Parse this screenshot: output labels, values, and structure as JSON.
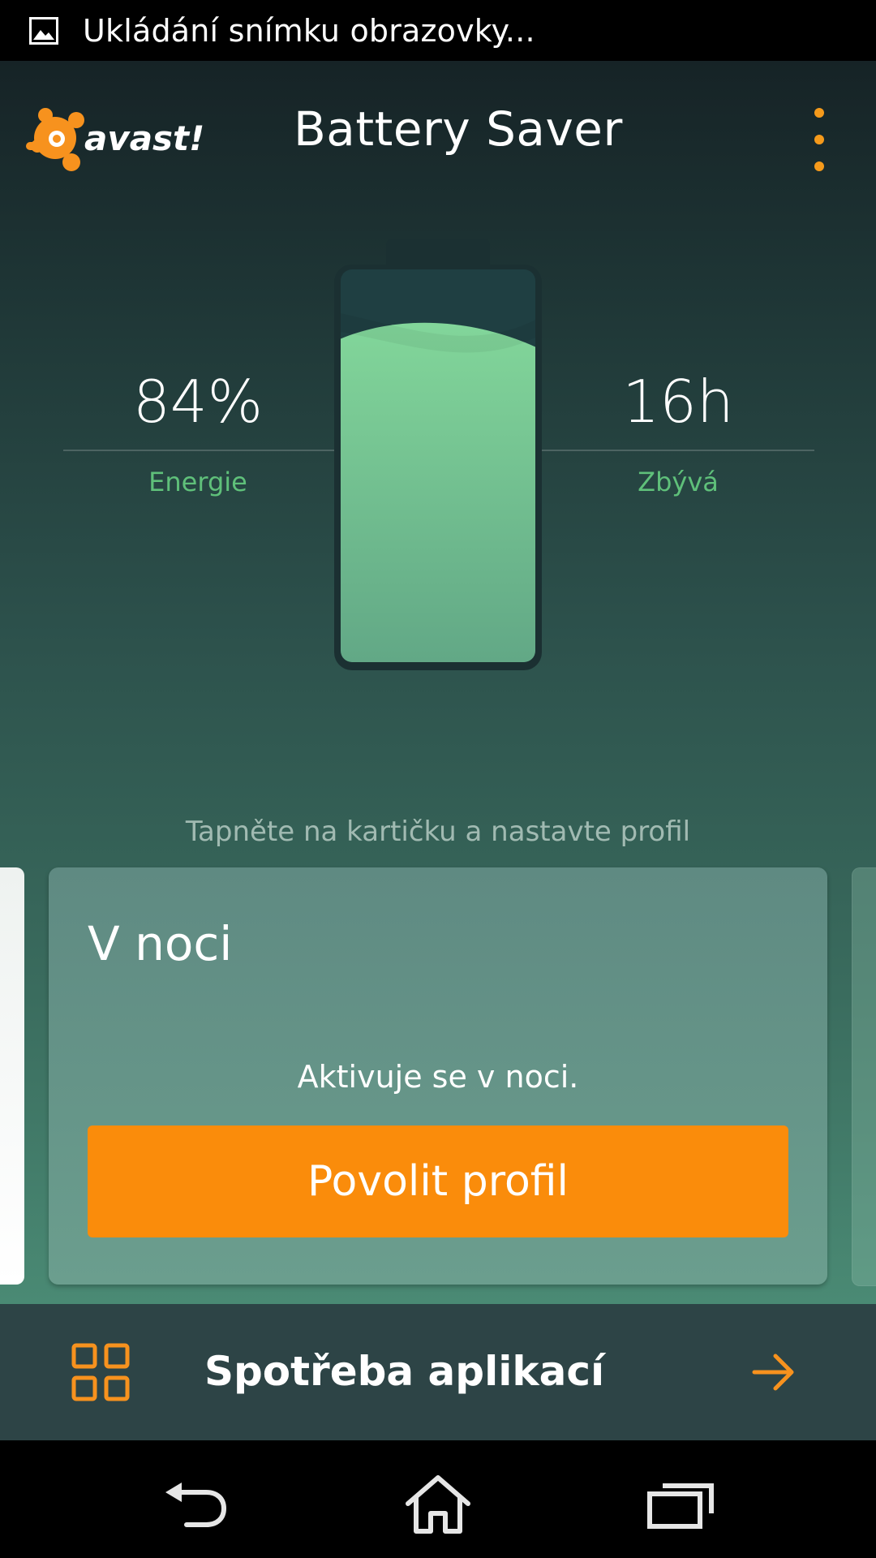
{
  "status_bar": {
    "notification_icon": "image-icon",
    "text": "Ukládání snímku obrazovky..."
  },
  "toolbar": {
    "logo_text": "avast!",
    "title": "Battery Saver",
    "menu_icon": "overflow-menu-icon"
  },
  "battery": {
    "level_percent": 84,
    "energy_value": "84%",
    "energy_label": "Energie",
    "remaining_value": "16h",
    "remaining_label": "Zbývá"
  },
  "profiles": {
    "hint": "Tapněte na kartičku a nastavte profil",
    "current": {
      "title": "V noci",
      "description": "Aktivuje se v noci.",
      "button_label": "Povolit profil"
    }
  },
  "bottom_bar": {
    "icon": "apps-grid-icon",
    "label": "Spotřeba aplikací",
    "arrow_icon": "arrow-right-icon"
  },
  "nav": {
    "back_icon": "back-icon",
    "home_icon": "home-icon",
    "recents_icon": "recents-icon"
  },
  "colors": {
    "accent": "#fa8c0b",
    "label_green": "#5fc07a",
    "battery_fill": "#7ccf95"
  }
}
